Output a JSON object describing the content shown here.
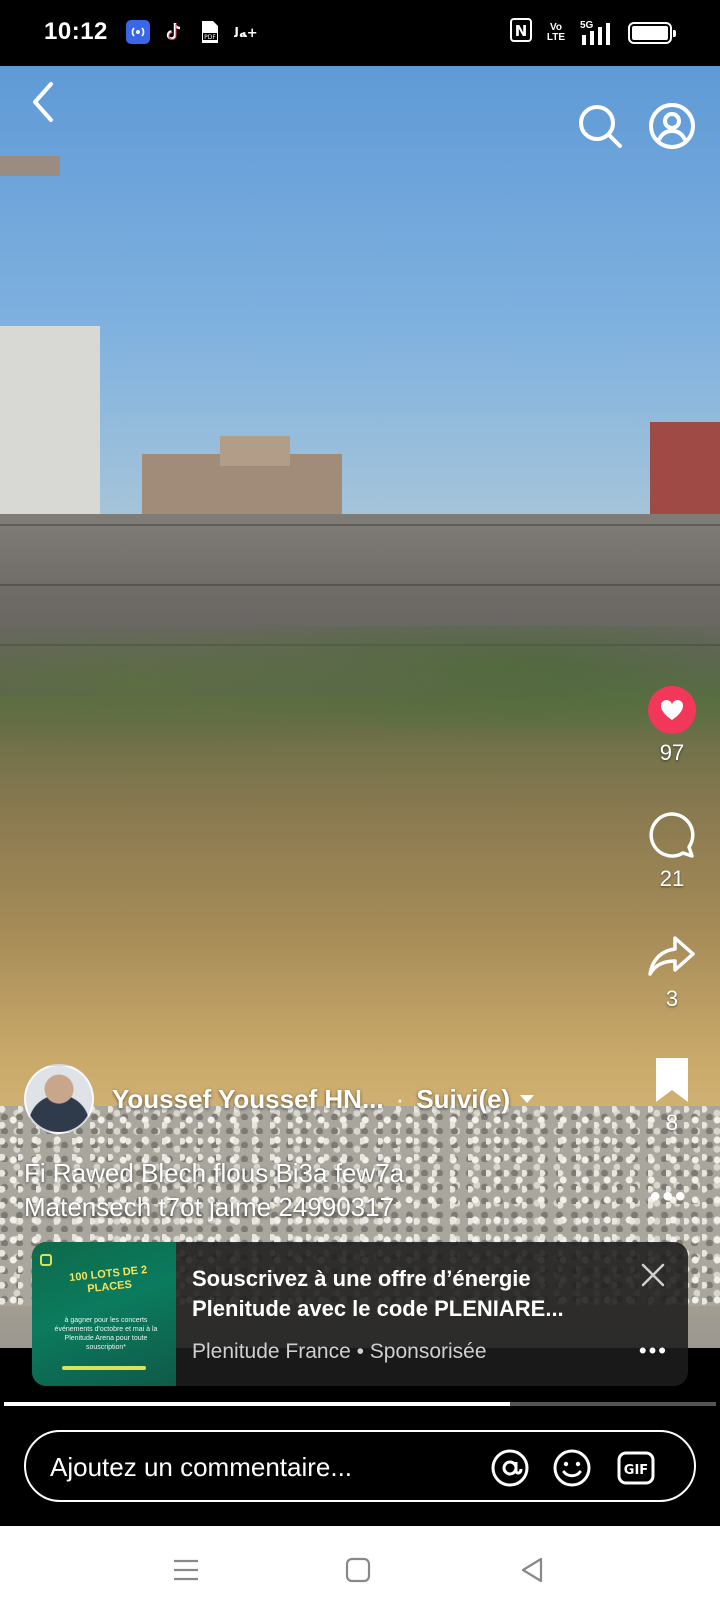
{
  "status_bar": {
    "time": "10:12",
    "left_icons": [
      "hotspot-icon",
      "tiktok-icon",
      "pdf-icon",
      "notification-icon"
    ],
    "nfc_label": "N",
    "volte_label": "Vo LTE",
    "network_label": "5G",
    "battery_level": 1.0
  },
  "top_bar": {
    "icons": [
      "back-icon",
      "search-icon",
      "profile-icon"
    ]
  },
  "actions": {
    "likes": "97",
    "comments": "21",
    "shares": "3",
    "saves": "8"
  },
  "author": {
    "name": "Youssef Youssef HN...",
    "follow_label": "Suivi(e)"
  },
  "caption": {
    "line1": "Fi  Rawed  Blech flous  Bi3a few7a",
    "line2": "Matensech t7ot jaime 24990317"
  },
  "ad": {
    "thumb_badge": "100 LOTS DE 2 PLACES",
    "thumb_text": "à gagner pour les concerts événements d'octobre et mai à la Plenitude Arena pour toute souscription*",
    "title_line1": "Souscrivez à une offre d’énergie",
    "title_line2": "Plenitude avec le code PLENIARE...",
    "advertiser": "Plenitude France",
    "sponsored_label": "Sponsorisée",
    "accent_color": "#d8e35a"
  },
  "video_progress": 0.71,
  "comment_bar": {
    "placeholder": "Ajoutez un commentaire...",
    "icons": [
      "mention-icon",
      "emoji-icon",
      "gif-icon"
    ]
  },
  "nav_bar": {
    "icons": [
      "menu-icon",
      "home-icon",
      "back-triangle-icon"
    ]
  }
}
